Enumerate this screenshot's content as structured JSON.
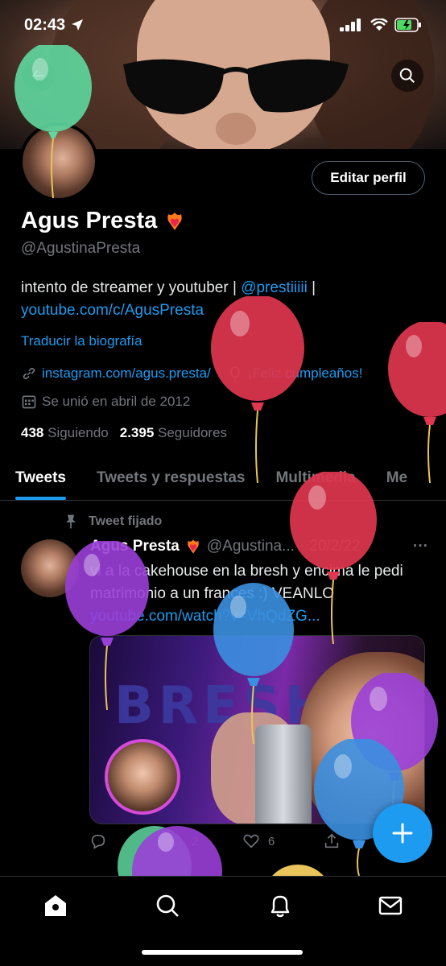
{
  "status_bar": {
    "time": "02:43"
  },
  "profile": {
    "edit_button": "Editar perfil",
    "name": "Agus Presta",
    "handle": "@AgustinaPresta",
    "bio_text": "intento de streamer y youtuber | ",
    "bio_mention": "@prestiiiii",
    "bio_sep": " |",
    "bio_link": "youtube.com/c/AgusPresta",
    "translate": "Traducir la biografía",
    "website": "instagram.com/agus.presta/",
    "birthday": "¡Feliz cumpleaños!",
    "joined": "Se unió en abril de 2012",
    "following_count": "438",
    "following_label": "Siguiendo",
    "followers_count": "2.395",
    "followers_label": "Seguidores"
  },
  "tabs": [
    "Tweets",
    "Tweets y respuestas",
    "Multimedia",
    "Me"
  ],
  "pinned_label": "Tweet fijado",
  "tweet": {
    "name": "Agus Presta",
    "handle": "@Agustina...",
    "sep": "·",
    "date": "20/2/22",
    "more": "···",
    "text": "vi a la cakehouse en la bresh y encima le pedi matrimonio a un frances :) VEANLO",
    "link": "youtube.com/watch?v=VhQdZG...",
    "media_text": "BRESH",
    "likes": "6",
    "retweets": "2"
  },
  "icons": [
    "back-icon",
    "search-icon",
    "link-icon",
    "balloon-icon",
    "calendar-icon",
    "pin-icon",
    "reply-icon",
    "retweet-icon",
    "like-icon",
    "share-icon",
    "compose-icon",
    "home-icon",
    "explore-icon",
    "notifications-icon",
    "messages-icon"
  ],
  "colors": {
    "accent": "#1d9bf0",
    "background": "#000000",
    "muted": "#71767b"
  }
}
